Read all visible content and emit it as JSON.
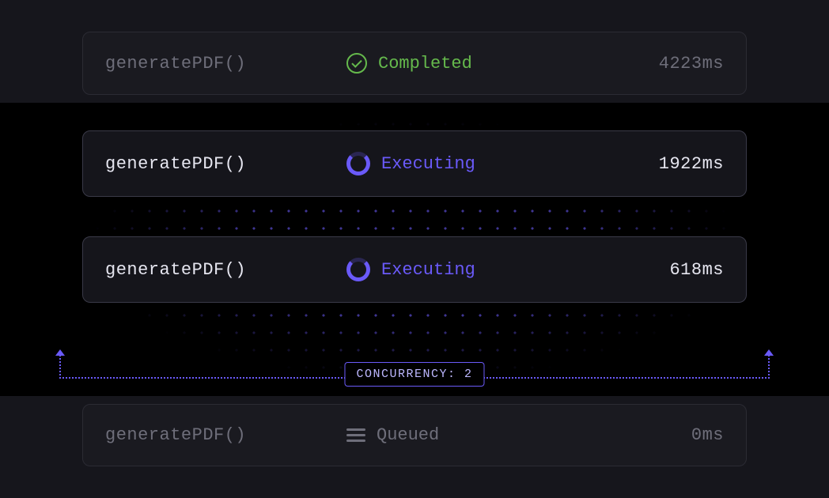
{
  "rows": {
    "completed": {
      "fn": "generatePDF()",
      "status_label": "Completed",
      "timing": "4223ms"
    },
    "executing1": {
      "fn": "generatePDF()",
      "status_label": "Executing",
      "timing": "1922ms"
    },
    "executing2": {
      "fn": "generatePDF()",
      "status_label": "Executing",
      "timing": "618ms"
    },
    "queued": {
      "fn": "generatePDF()",
      "status_label": "Queued",
      "timing": "0ms"
    }
  },
  "concurrency": {
    "label": "CONCURRENCY: 2"
  }
}
